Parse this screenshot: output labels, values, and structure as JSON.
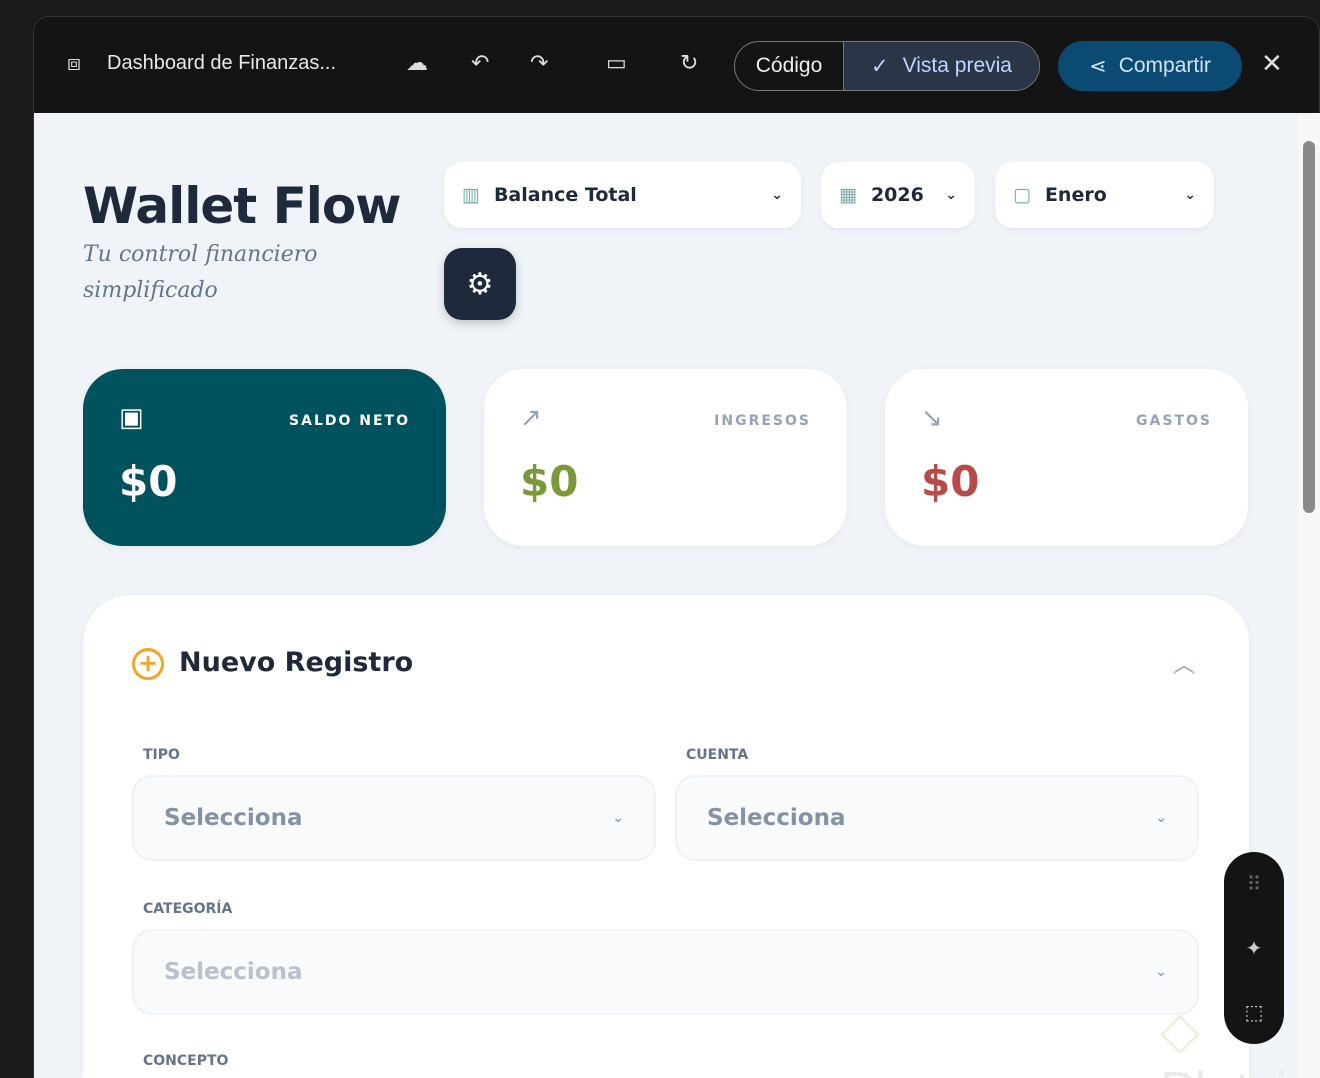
{
  "topbar": {
    "title": "Dashboard de Finanzas...",
    "code_label": "Código",
    "preview_label": "Vista previa",
    "share_label": "Compartir"
  },
  "header": {
    "brand": "Wallet Flow",
    "subtitle": "Tu control financiero simplificado"
  },
  "filters": {
    "view": "Balance Total",
    "year": "2026",
    "month": "Enero"
  },
  "cards": [
    {
      "label": "SALDO NETO",
      "value": "$0"
    },
    {
      "label": "INGRESOS",
      "value": "$0"
    },
    {
      "label": "GASTOS",
      "value": "$0"
    }
  ],
  "form": {
    "title": "Nuevo Registro",
    "fields": [
      {
        "label": "TIPO",
        "value": "Selecciona"
      },
      {
        "label": "CUENTA",
        "value": "Selecciona"
      },
      {
        "label": "CATEGORÍA",
        "value": "Selecciona"
      },
      {
        "label": "CONCEPTO"
      }
    ]
  },
  "watermark": "Platzi",
  "colors": {
    "primary": "#00525f",
    "income": "#7a9a3a",
    "expense": "#b84a4a"
  }
}
